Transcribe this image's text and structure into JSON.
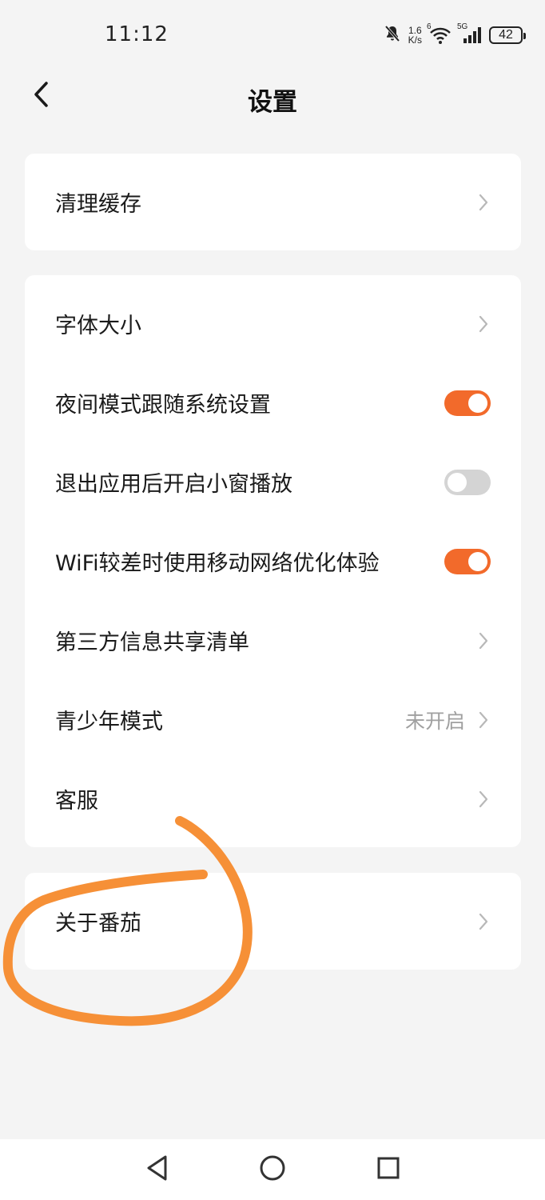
{
  "status_bar": {
    "time": "11:12",
    "net_speed_value": "1.6",
    "net_speed_unit": "K/s",
    "wifi_badge": "6",
    "signal_badge": "5G",
    "battery": "42"
  },
  "header": {
    "title": "设置"
  },
  "cards": {
    "cache": {
      "label": "清理缓存"
    },
    "font_size": {
      "label": "字体大小"
    },
    "night_mode": {
      "label": "夜间模式跟随系统设置",
      "enabled": true
    },
    "mini_window": {
      "label": "退出应用后开启小窗播放",
      "enabled": false
    },
    "wifi_optimize": {
      "label": "WiFi较差时使用移动网络优化体验",
      "enabled": true
    },
    "third_party": {
      "label": "第三方信息共享清单"
    },
    "youth_mode": {
      "label": "青少年模式",
      "value": "未开启"
    },
    "customer_service": {
      "label": "客服"
    },
    "about": {
      "label": "关于番茄"
    }
  },
  "icons": {
    "back": "chevron-left-icon",
    "chevron": "chevron-right-icon",
    "mute": "bell-off-icon",
    "wifi": "wifi-icon",
    "signal": "signal-icon",
    "nav_back": "triangle-back-icon",
    "nav_home": "circle-home-icon",
    "nav_recents": "square-recents-icon"
  },
  "colors": {
    "accent": "#f26a2b",
    "annotation": "#f58a2c",
    "background": "#f4f4f4",
    "card": "#ffffff",
    "secondary_text": "#a0a0a0"
  }
}
